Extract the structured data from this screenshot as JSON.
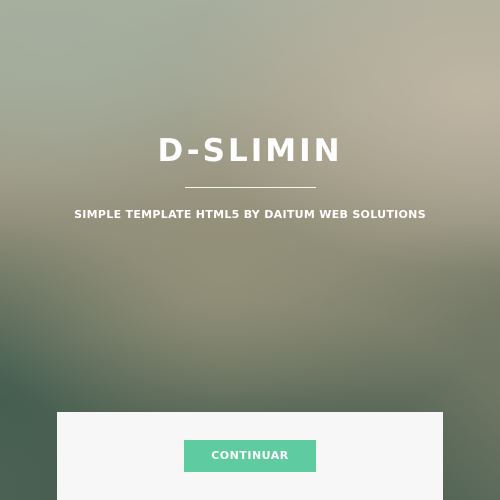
{
  "hero": {
    "title": "D-SLIMIN",
    "subtitle": "SIMPLE TEMPLATE HTML5 BY DAITUM WEB SOLUTIONS"
  },
  "panel": {
    "button_label": "CONTINUAR"
  },
  "colors": {
    "accent": "#5ecba1",
    "panel_background": "#f7f7f7",
    "text_light": "#ffffff"
  }
}
